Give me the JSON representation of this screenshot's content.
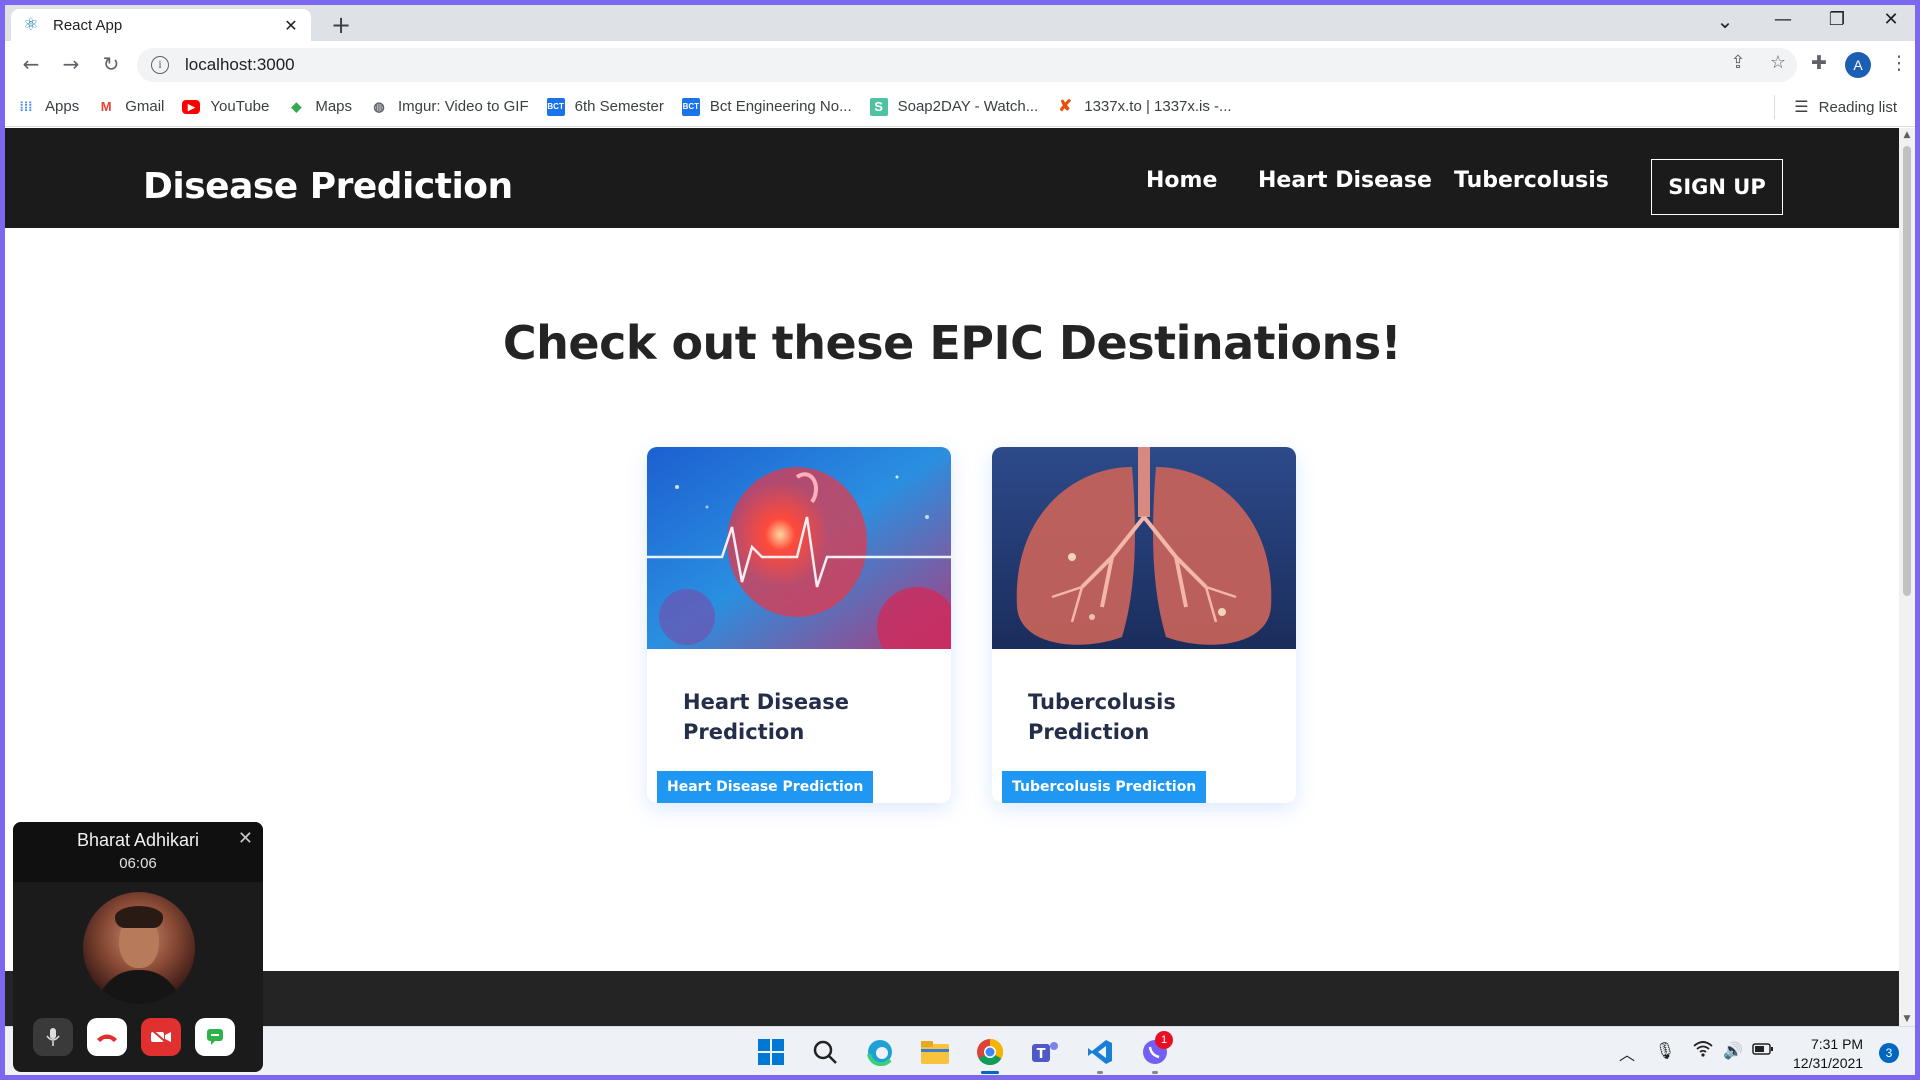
{
  "browser": {
    "tab_title": "React App",
    "tab_close": "✕",
    "new_tab": "+",
    "url": "localhost:3000",
    "window_controls": {
      "dropdown": "⌄",
      "minimize": "—",
      "restore": "❐",
      "close": "✕"
    }
  },
  "bookmarks": {
    "items": [
      {
        "label": "Apps",
        "icon": "apps-grid-icon",
        "color": "#4285f4"
      },
      {
        "label": "Gmail",
        "icon": "gmail-icon",
        "color": "#ea4335"
      },
      {
        "label": "YouTube",
        "icon": "youtube-icon",
        "color": "#ff0000"
      },
      {
        "label": "Maps",
        "icon": "maps-icon",
        "color": "#34a853"
      },
      {
        "label": "Imgur: Video to GIF",
        "icon": "globe-icon",
        "color": "#5f6368"
      },
      {
        "label": "6th Semester",
        "icon": "bct-icon",
        "color": "#1a73e8"
      },
      {
        "label": "Bct Engineering No...",
        "icon": "bct-icon",
        "color": "#1a73e8"
      },
      {
        "label": "Soap2DAY - Watch...",
        "icon": "soap-icon",
        "color": "#4fc3a1"
      },
      {
        "label": "1337x.to | 1337x.is -...",
        "icon": "x-icon",
        "color": "#e8500e"
      }
    ],
    "reading_list": "Reading list"
  },
  "site": {
    "brand": "Disease Prediction",
    "nav": [
      "Home",
      "Heart Disease",
      "Tubercolusis"
    ],
    "signup": "SIGN UP",
    "heading": "Check out these EPIC Destinations!",
    "cards": [
      {
        "badge": "Heart Disease Prediction",
        "title": "Heart Disease Prediction"
      },
      {
        "badge": "Tubercolusis Prediction",
        "title": "Tubercolusis Prediction"
      }
    ],
    "colors": {
      "nav_bg": "#1c1b1b",
      "badge_bg": "#1f98f4",
      "card_title": "#252e48"
    }
  },
  "call": {
    "name": "Bharat Adhikari",
    "duration": "06:06",
    "close": "✕"
  },
  "taskbar": {
    "time": "7:31 PM",
    "date": "12/31/2021",
    "notifications": "3",
    "viber_badge": "1"
  }
}
